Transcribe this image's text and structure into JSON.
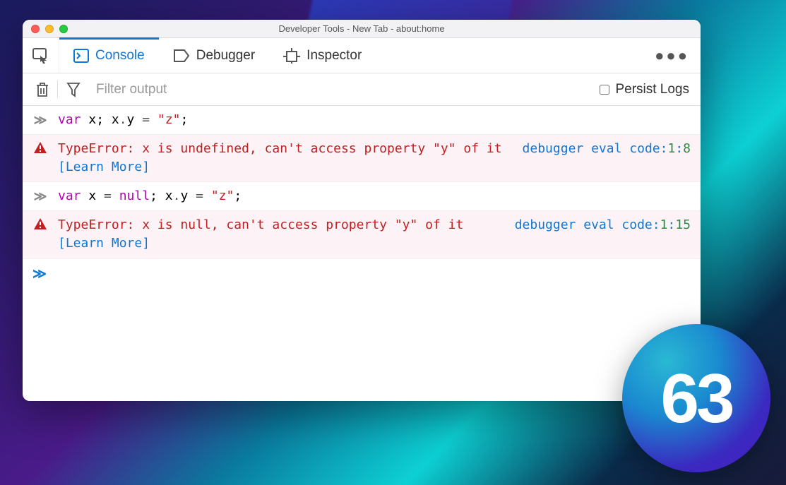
{
  "window": {
    "title": "Developer Tools - New Tab - about:home"
  },
  "tabs": {
    "console": "Console",
    "debugger": "Debugger",
    "inspector": "Inspector"
  },
  "filter": {
    "placeholder": "Filter output",
    "persist_label": "Persist Logs"
  },
  "rows": [
    {
      "type": "input",
      "code": {
        "kw": "var",
        "rest1": " x; x",
        "op": ".",
        "rest2": "y ",
        "eq": "=",
        "sp": " ",
        "str": "\"z\"",
        "semi": ";"
      }
    },
    {
      "type": "error",
      "msg": "TypeError: x is undefined, can't access property \"y\" of it",
      "learn": "[Learn More]",
      "loc_source": "debugger eval code",
      "loc_line": "1",
      "loc_col": "8"
    },
    {
      "type": "input",
      "code": {
        "kw": "var",
        "rest1": " x ",
        "eq": "=",
        "sp": " ",
        "null": "null",
        "semi1": "; x",
        "op": ".",
        "rest2": "y ",
        "eq2": "=",
        "sp2": " ",
        "str": "\"z\"",
        "semi": ";"
      }
    },
    {
      "type": "error",
      "msg": "TypeError: x is null, can't access property \"y\" of it",
      "learn": "[Learn More]",
      "loc_source": "debugger eval code",
      "loc_line": "1",
      "loc_col": "15"
    }
  ],
  "badge": {
    "version": "63"
  }
}
